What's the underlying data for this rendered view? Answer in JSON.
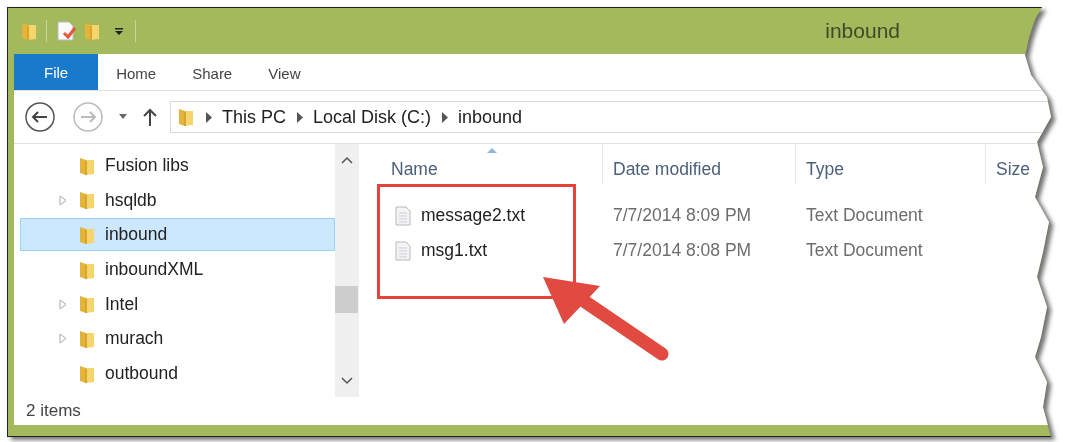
{
  "window": {
    "title": "inbound"
  },
  "ribbon_tabs": [
    {
      "label": "File",
      "kind": "file"
    },
    {
      "label": "Home",
      "kind": "tab"
    },
    {
      "label": "Share",
      "kind": "tab"
    },
    {
      "label": "View",
      "kind": "tab"
    }
  ],
  "breadcrumbs": [
    "This PC",
    "Local Disk (C:)",
    "inbound"
  ],
  "sidebar": {
    "items": [
      {
        "label": "Fusion libs",
        "expandable": false,
        "selected": false
      },
      {
        "label": "hsqldb",
        "expandable": true,
        "selected": false
      },
      {
        "label": "inbound",
        "expandable": false,
        "selected": true
      },
      {
        "label": "inboundXML",
        "expandable": false,
        "selected": false
      },
      {
        "label": "Intel",
        "expandable": true,
        "selected": false
      },
      {
        "label": "murach",
        "expandable": true,
        "selected": false
      },
      {
        "label": "outbound",
        "expandable": false,
        "selected": false
      }
    ]
  },
  "table": {
    "columns": [
      {
        "label": "Name",
        "sorted": true
      },
      {
        "label": "Date modified",
        "sorted": false
      },
      {
        "label": "Type",
        "sorted": false
      },
      {
        "label": "Size",
        "sorted": false
      }
    ],
    "rows": [
      {
        "name": "message2.txt",
        "date": "7/7/2014 8:09 PM",
        "type": "Text Document"
      },
      {
        "name": "msg1.txt",
        "date": "7/7/2014 8:08 PM",
        "type": "Text Document"
      }
    ]
  },
  "status_bar": "2 items"
}
